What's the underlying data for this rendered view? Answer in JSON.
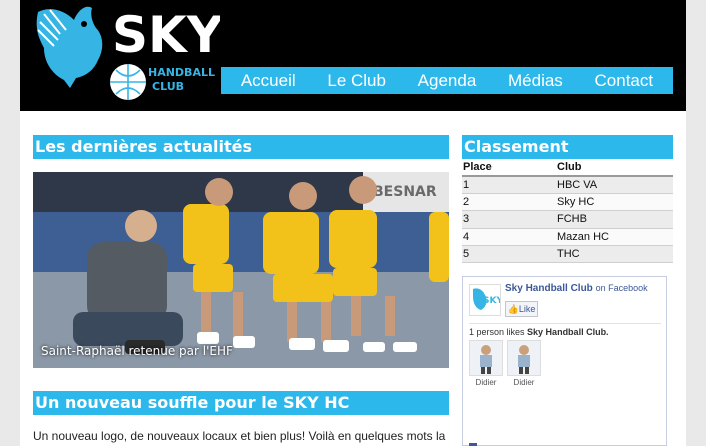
{
  "header": {
    "logo_text": "SKY",
    "logo_sub1": "HANDBALL",
    "logo_sub2": "CLUB",
    "nav": [
      "Accueil",
      "Le Club",
      "Agenda",
      "Médias",
      "Contact"
    ]
  },
  "news": {
    "heading": "Les dernières actualités",
    "photo_caption": "Saint-Raphaël retenue par l'EHF",
    "photo_sign": "BESNAR"
  },
  "article": {
    "heading": "Un nouveau souffle pour le SKY HC",
    "intro": "Un nouveau logo, de nouveaux locaux et bien plus! Voilà en quelques mots la"
  },
  "ranking": {
    "heading": "Classement",
    "col_place": "Place",
    "col_club": "Club",
    "rows": [
      {
        "place": "1",
        "club": "HBC VA"
      },
      {
        "place": "2",
        "club": "Sky HC"
      },
      {
        "place": "3",
        "club": "FCHB"
      },
      {
        "place": "4",
        "club": "Mazan HC"
      },
      {
        "place": "5",
        "club": "THC"
      }
    ]
  },
  "facebook": {
    "page_name": "Sky Handball Club",
    "on_facebook": "on Facebook",
    "like_label": "Like",
    "count_prefix": "1 person likes",
    "count_name": "Sky Handball Club.",
    "fans": [
      "Didier",
      "Didier"
    ]
  },
  "colors": {
    "accent": "#2db8ec",
    "header_bg": "#000000",
    "fb_blue": "#3b5998"
  }
}
